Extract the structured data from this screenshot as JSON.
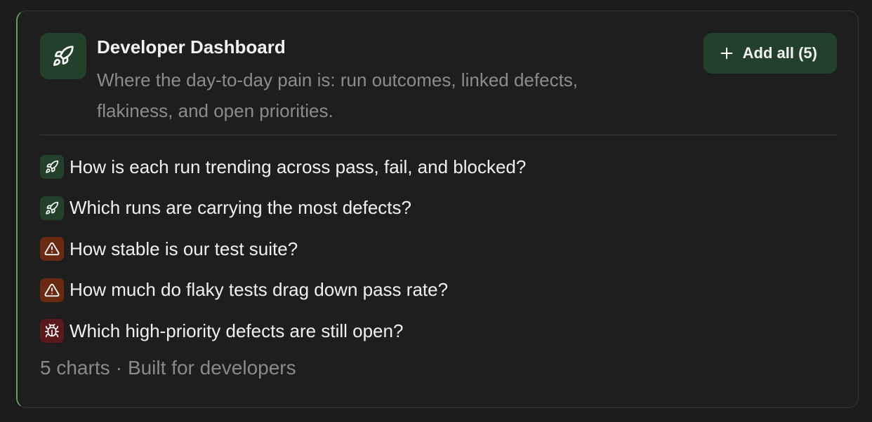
{
  "dashboard": {
    "title": "Developer Dashboard",
    "description": "Where the day-to-day pain is: run outcomes, linked defects, flakiness, and open priorities.",
    "icon": "rocket-icon",
    "accent_color": "#5fa35c",
    "add_all_label": "Add all (5)"
  },
  "charts": [
    {
      "label": "How is each run trending across pass, fail, and blocked?",
      "icon": "rocket-icon",
      "color": "#23402a"
    },
    {
      "label": "Which runs are carrying the most defects?",
      "icon": "rocket-icon",
      "color": "#23402a"
    },
    {
      "label": "How stable is our test suite?",
      "icon": "warning-icon",
      "color": "#6a2a12"
    },
    {
      "label": "How much do flaky tests drag down pass rate?",
      "icon": "warning-icon",
      "color": "#6a2a12"
    },
    {
      "label": "Which high-priority defects are still open?",
      "icon": "bug-icon",
      "color": "#5a1a1c"
    }
  ],
  "footer": {
    "count_text": "5 charts",
    "separator": "·",
    "audience_text": "Built for developers"
  }
}
